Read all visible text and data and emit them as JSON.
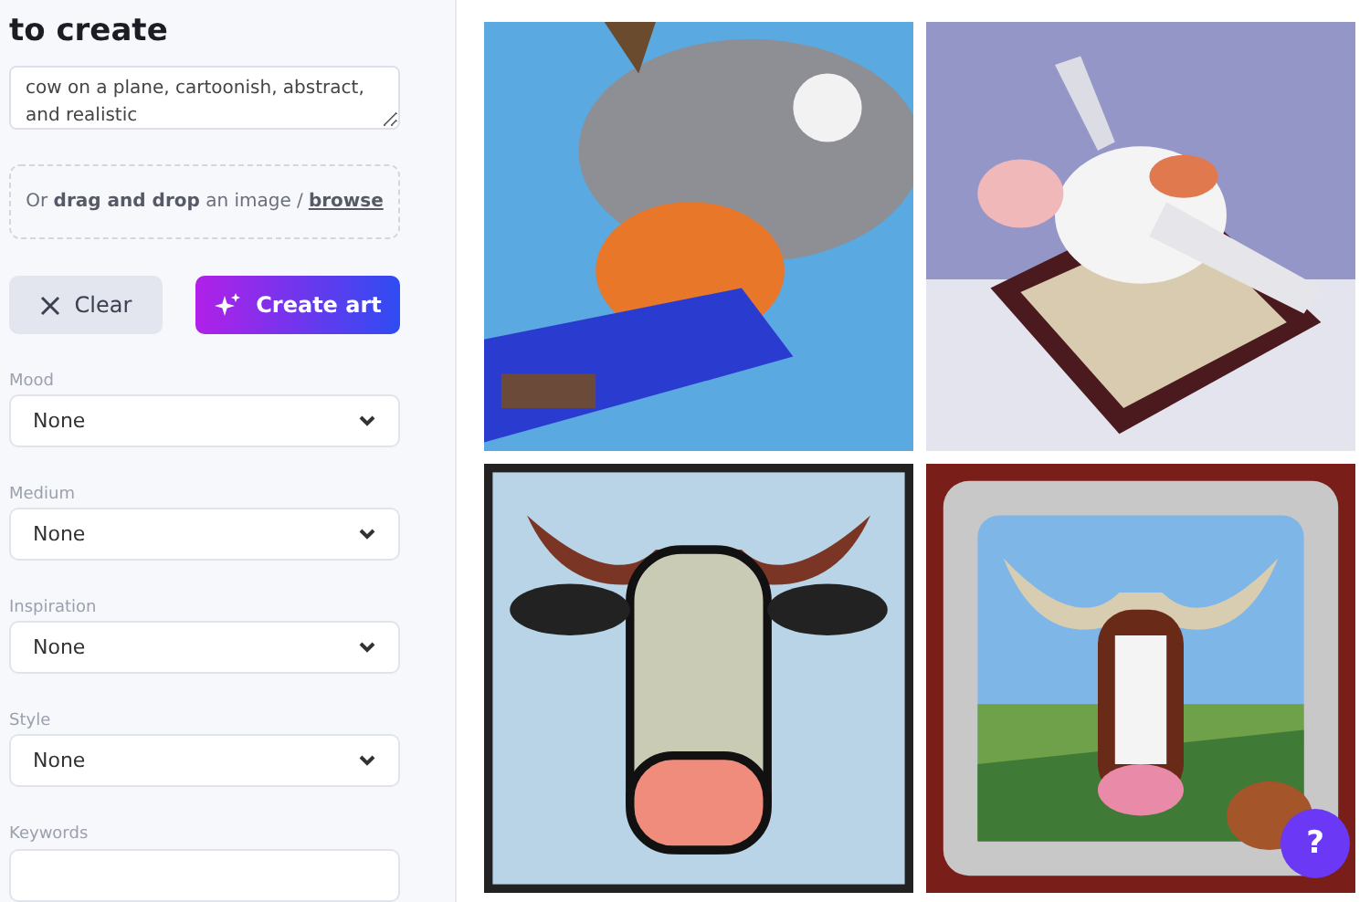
{
  "heading": "to create",
  "prompt": {
    "value": "cow on a plane, cartoonish, abstract, and realistic"
  },
  "dropzone": {
    "text": "Or **drag and drop** an image /",
    "link": "browse"
  },
  "buttons": [
    {
      "kind": "clear",
      "label": "Clear"
    },
    {
      "kind": "create",
      "label": "Create art"
    }
  ],
  "filters": [
    {
      "label": "Mood",
      "value": "None"
    },
    {
      "label": "Medium",
      "value": "None"
    },
    {
      "label": "Inspiration",
      "value": "None"
    },
    {
      "label": "Style",
      "value": "None"
    }
  ],
  "keywords": {
    "label": "Keywords"
  },
  "help": {
    "label": "?"
  }
}
